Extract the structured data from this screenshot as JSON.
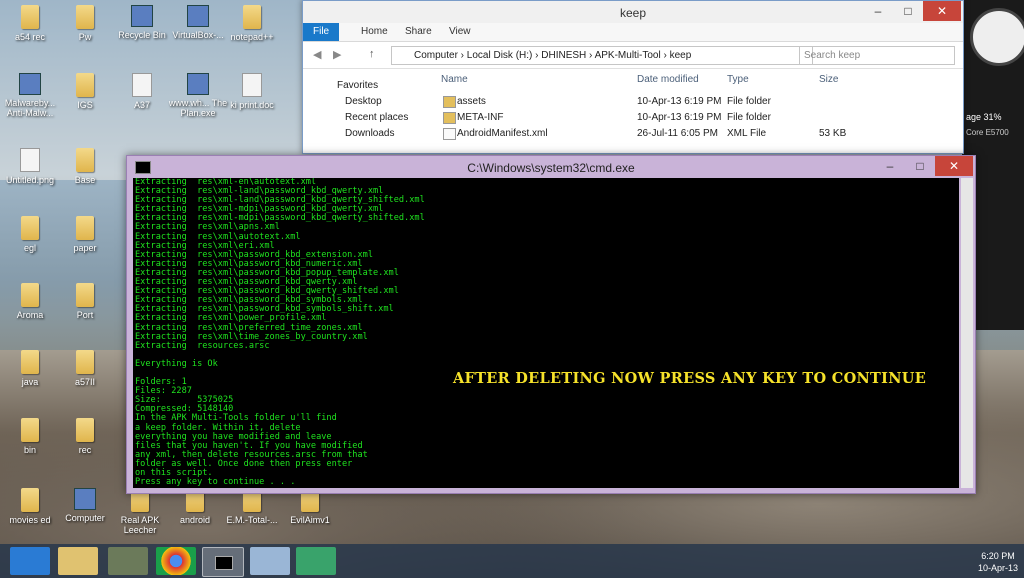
{
  "desktop": {
    "icons": [
      {
        "label": "a54 rec",
        "kind": "folder"
      },
      {
        "label": "Pw",
        "kind": "folder"
      },
      {
        "label": "Recycle Bin",
        "kind": "app"
      },
      {
        "label": "VirtualBox-...",
        "kind": "app"
      },
      {
        "label": "notepad++",
        "kind": "folder"
      },
      {
        "label": "Malwareby... Anti-Malw...",
        "kind": "app"
      },
      {
        "label": "IGS",
        "kind": "folder"
      },
      {
        "label": "A37",
        "kind": "file"
      },
      {
        "label": "www.wh... The Plan.exe",
        "kind": "app"
      },
      {
        "label": "ki print.doc",
        "kind": "file"
      },
      {
        "label": "Untitled.png",
        "kind": "file"
      },
      {
        "label": "Base",
        "kind": "folder"
      },
      {
        "label": "egl",
        "kind": "folder"
      },
      {
        "label": "paper",
        "kind": "folder"
      },
      {
        "label": "Aroma",
        "kind": "folder"
      },
      {
        "label": "Port",
        "kind": "folder"
      },
      {
        "label": "java",
        "kind": "folder"
      },
      {
        "label": "a57II",
        "kind": "folder"
      },
      {
        "label": "bin",
        "kind": "folder"
      },
      {
        "label": "rec",
        "kind": "folder"
      },
      {
        "label": "movies ed",
        "kind": "folder"
      },
      {
        "label": "Computer",
        "kind": "app"
      },
      {
        "label": "Real APK Leecher",
        "kind": "folder"
      },
      {
        "label": "android",
        "kind": "folder"
      },
      {
        "label": "E.M.-Total-...",
        "kind": "folder"
      },
      {
        "label": "EvilAimv1",
        "kind": "folder"
      }
    ]
  },
  "explorer": {
    "title": "keep",
    "tabs": [
      "File",
      "Home",
      "Share",
      "View"
    ],
    "breadcrumb": "Computer  ›  Local Disk (H:)  ›  DHINESH  ›  APK-Multi-Tool  ›  keep",
    "search_placeholder": "Search keep",
    "nav": [
      "Favorites",
      "Desktop",
      "Recent places",
      "Downloads"
    ],
    "columns": [
      "Name",
      "Date modified",
      "Type",
      "Size"
    ],
    "rows": [
      {
        "name": "assets",
        "date": "10-Apr-13 6:19 PM",
        "type": "File folder",
        "size": ""
      },
      {
        "name": "META-INF",
        "date": "10-Apr-13 6:19 PM",
        "type": "File folder",
        "size": ""
      },
      {
        "name": "AndroidManifest.xml",
        "date": "26-Jul-11 6:05 PM",
        "type": "XML File",
        "size": "53 KB"
      }
    ]
  },
  "cmd": {
    "title": "C:\\Windows\\system32\\cmd.exe",
    "lines": [
      "Extracting  res\\xml-en\\autotext.xml",
      "Extracting  res\\xml-land\\password_kbd_qwerty.xml",
      "Extracting  res\\xml-land\\password_kbd_qwerty_shifted.xml",
      "Extracting  res\\xml-mdpi\\password_kbd_qwerty.xml",
      "Extracting  res\\xml-mdpi\\password_kbd_qwerty_shifted.xml",
      "Extracting  res\\xml\\apns.xml",
      "Extracting  res\\xml\\autotext.xml",
      "Extracting  res\\xml\\eri.xml",
      "Extracting  res\\xml\\password_kbd_extension.xml",
      "Extracting  res\\xml\\password_kbd_numeric.xml",
      "Extracting  res\\xml\\password_kbd_popup_template.xml",
      "Extracting  res\\xml\\password_kbd_qwerty.xml",
      "Extracting  res\\xml\\password_kbd_qwerty_shifted.xml",
      "Extracting  res\\xml\\password_kbd_symbols.xml",
      "Extracting  res\\xml\\password_kbd_symbols_shift.xml",
      "Extracting  res\\xml\\power_profile.xml",
      "Extracting  res\\xml\\preferred_time_zones.xml",
      "Extracting  res\\xml\\time_zones_by_country.xml",
      "Extracting  resources.arsc",
      "",
      "Everything is Ok",
      "",
      "Folders: 1",
      "Files: 2287",
      "Size:       5375025",
      "Compressed: 5148140",
      "In the APK Multi-Tools folder u'll find",
      "a keep folder. Within it, delete",
      "everything you have modified and leave",
      "files that you haven't. If you have modified",
      "any xml, then delete resources.arsc from that",
      "folder as well. Once done then press enter",
      "on this script.",
      "Press any key to continue . . ."
    ],
    "overlay": "AFTER DELETING NOW PRESS ANY KEY TO CONTINUE"
  },
  "gadget": {
    "cpu": "age 31%",
    "model": "Core E5700"
  },
  "taskbar": {
    "time": "6:20 PM",
    "date": "10-Apr-13"
  }
}
